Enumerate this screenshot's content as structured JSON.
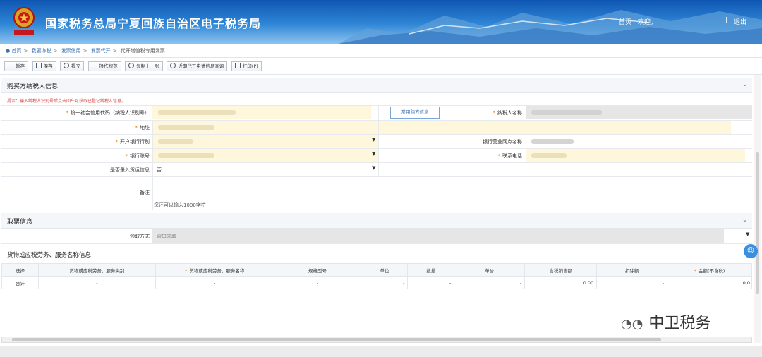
{
  "header": {
    "title": "国家税务总局宁夏回族自治区电子税务局",
    "home": "首页",
    "welcome": "欢迎，",
    "separator": "|",
    "logout": "退出"
  },
  "breadcrumb": {
    "items": [
      "首页",
      "我要办税",
      "发票使用",
      "发票代开"
    ],
    "current": "代开增值税专用发票"
  },
  "toolbar": {
    "save_draft": "暂存",
    "save": "保存",
    "submit": "提交",
    "guide": "操作规范",
    "copy_last": "复制上一张",
    "recent_query": "近期代开申请信息查询",
    "print": "打印(P)"
  },
  "buyer": {
    "section_title": "购买方纳税人信息",
    "tip": "提示：输入纳税人识别号后点击回车可获取已登记纳税人信息。",
    "credit_code_label": "统一社会信用代码（纳税人识别号）",
    "buyer_btn": "常用购方信息",
    "name_label": "纳税人名称",
    "address_label": "地址",
    "bank_label": "开户银行行别",
    "branch_label": "银行营业网点名称",
    "account_label": "银行账号",
    "phone_label": "联系电话",
    "cargo_label": "是否录入货运信息",
    "cargo_value": "否",
    "remark_label": "备注",
    "remark_hint": "您还可以输入1000字符"
  },
  "pickup": {
    "section_title": "取票信息",
    "method_label": "领取方式",
    "method_value": "窗口领取"
  },
  "goods": {
    "section_title": "货物或应税劳务、服务名称信息",
    "columns": [
      "选择",
      "货物或应税劳务、服务类别",
      "货物或应税劳务、服务名称",
      "规格型号",
      "单位",
      "数量",
      "单价",
      "含税销售额",
      "扣除额",
      "金额(不含税)"
    ],
    "total_row": [
      "合计",
      "-",
      "-",
      "-",
      "-",
      "-",
      "-",
      "0.00",
      "-",
      "0.0"
    ]
  },
  "watermark": "中卫税务",
  "colors": {
    "header_blue": "#1a62bf",
    "required": "#e07b00",
    "tip_red": "#d84040",
    "field_yellow": "#fff7dc"
  }
}
